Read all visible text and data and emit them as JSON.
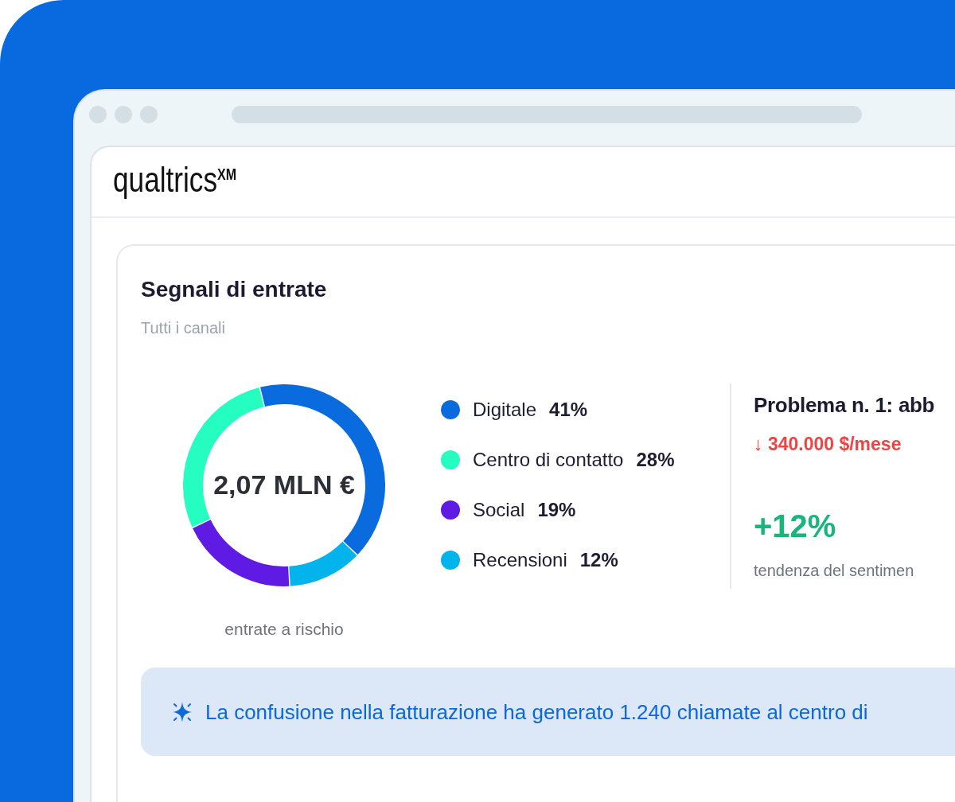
{
  "header": {
    "logo": "qualtrics$^{XM}$"
  },
  "card": {
    "title": "Segnali di entrate",
    "subtitle": "Tutti i canali",
    "donut": {
      "center_value": "2,07 MLN €",
      "caption": "entrate a rischio",
      "chart_data": {
        "type": "donut",
        "categories": [
          "Digitale",
          "Centro di contatto",
          "Social",
          "Recensioni"
        ],
        "values": [
          41,
          28,
          19,
          12
        ]
      }
    },
    "legend": [
      {
        "value": "41%",
        "color": "#0a6bde"
      },
      {
        "value": "28%",
        "color": "#26fdc1"
      },
      {
        "value": "19%",
        "color": "#5f1be3"
      },
      {
        "value": "12%",
        "color": "#03b4ec"
      }
    ],
    "issue": {
      "title": "Problema n. 1: abb",
      "amount": "↓ 340.000 $/mese",
      "amount_negative": true,
      "change": "+12%",
      "change_positive": true,
      "change_label": "tendenza del sentimen"
    },
    "insight": {
      "text": "La confusione nella fatturazione ha generato 1.240 chiamate al centro di"
    }
  }
}
